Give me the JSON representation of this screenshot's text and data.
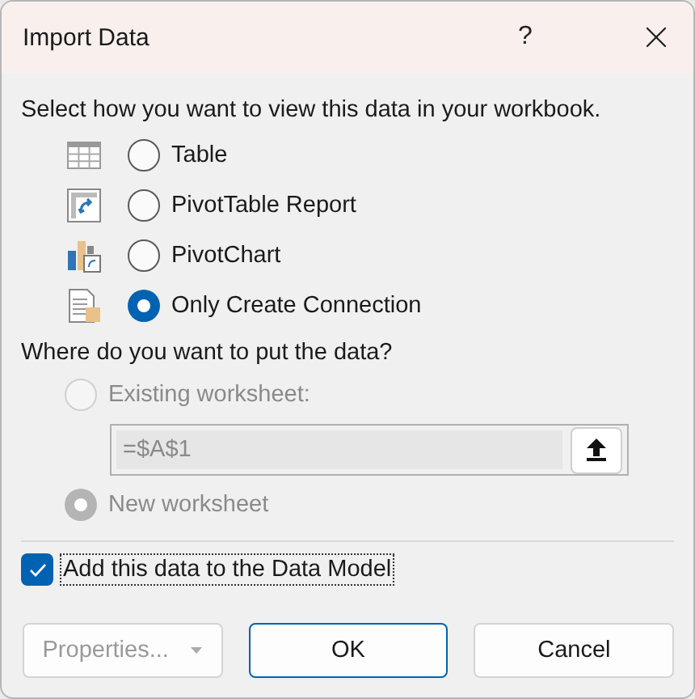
{
  "window": {
    "title": "Import Data",
    "help": "?"
  },
  "view_prompt": "Select how you want to view this data in your workbook.",
  "views": [
    {
      "kind": "table",
      "label": "Table",
      "selected": false
    },
    {
      "kind": "pivottable",
      "label": "PivotTable Report",
      "selected": false
    },
    {
      "kind": "pivotchart",
      "label": "PivotChart",
      "selected": false
    },
    {
      "kind": "connection",
      "label": "Only Create Connection",
      "selected": true
    }
  ],
  "location_prompt": "Where do you want to put the data?",
  "locations": [
    {
      "kind": "existing",
      "label": "Existing worksheet:",
      "selected": false,
      "disabled": true
    },
    {
      "kind": "new",
      "label": "New worksheet",
      "selected": true,
      "disabled": true
    }
  ],
  "reference": {
    "value": "=$A$1",
    "disabled": true
  },
  "data_model": {
    "label": "Add this data to the Data Model",
    "checked": true
  },
  "buttons": [
    {
      "label": "Properties...",
      "disabled": true,
      "dropdown": true,
      "default": false
    },
    {
      "label": "OK",
      "disabled": false,
      "dropdown": false,
      "default": true
    },
    {
      "label": "Cancel",
      "disabled": false,
      "dropdown": false,
      "default": false
    }
  ]
}
